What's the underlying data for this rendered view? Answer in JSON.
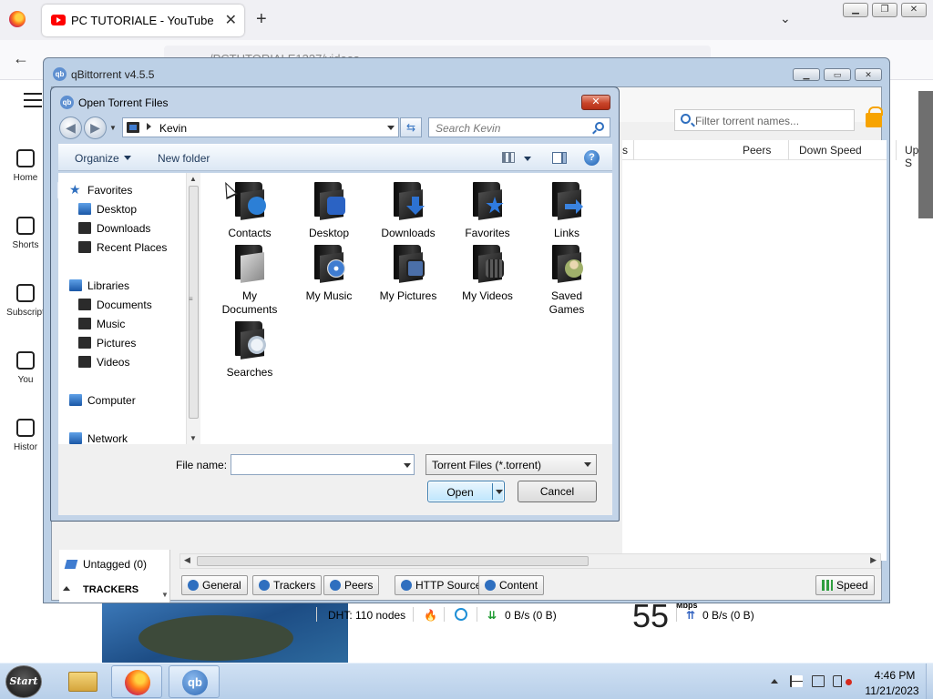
{
  "browser": {
    "tab_title": "PC TUTORIALE - YouTube",
    "tab_close": "✕",
    "new_tab": "+",
    "tab_list": "⌄",
    "url_partial": "/PCTUTORIALE1337/videos",
    "back_arrow": "←"
  },
  "youtube_sidebar": {
    "items": [
      {
        "label": "Home",
        "icon": "home-icon"
      },
      {
        "label": "Shorts",
        "icon": "shorts-icon"
      },
      {
        "label": "Subscript",
        "icon": "subscriptions-icon"
      },
      {
        "label": "You",
        "icon": "library-icon"
      },
      {
        "label": "Histor",
        "icon": "history-icon"
      }
    ]
  },
  "youtube_content": {
    "speed_value": "55",
    "speed_unit": "Mbps"
  },
  "qbittorrent": {
    "title": "qBittorrent v4.5.5",
    "filter_placeholder": "Filter torrent names...",
    "columns": [
      "s",
      "Peers",
      "Down Speed",
      "Up S"
    ],
    "untagged": "Untagged (0)",
    "trackers_header": "TRACKERS",
    "bottom_tabs": [
      "General",
      "Trackers",
      "Peers",
      "HTTP Sources",
      "Content"
    ],
    "speed_tab": "Speed",
    "status": {
      "dht": "DHT: 110 nodes",
      "download": "0 B/s (0 B)",
      "upload": "0 B/s (0 B)"
    }
  },
  "dialog": {
    "title": "Open Torrent Files",
    "close_symbol": "✕",
    "address": "Kevin",
    "search_placeholder": "Search Kevin",
    "organize": "Organize",
    "new_folder": "New folder",
    "help_symbol": "?",
    "nav": {
      "favorites": "Favorites",
      "favorites_items": [
        "Desktop",
        "Downloads",
        "Recent Places"
      ],
      "libraries": "Libraries",
      "libraries_items": [
        "Documents",
        "Music",
        "Pictures",
        "Videos"
      ],
      "computer": "Computer",
      "network": "Network"
    },
    "folders": [
      {
        "label": "Contacts",
        "accent": "#2c7fd6"
      },
      {
        "label": "Desktop",
        "accent": "#2b63c4"
      },
      {
        "label": "Downloads",
        "accent": "#2d72d2"
      },
      {
        "label": "Favorites",
        "accent": "#2f7be0"
      },
      {
        "label": "Links",
        "accent": "#3a83e0"
      },
      {
        "label": "My Documents",
        "accent": "#9a9a9a"
      },
      {
        "label": "My Music",
        "accent": "#3f7cd0"
      },
      {
        "label": "My Pictures",
        "accent": "#4b6fa8"
      },
      {
        "label": "My Videos",
        "accent": "#5a5a5a"
      },
      {
        "label": "Saved Games",
        "accent": "#a0b06a"
      },
      {
        "label": "Searches",
        "accent": "#b9c7d6"
      }
    ],
    "file_name_label": "File name:",
    "file_name_value": "",
    "file_type": "Torrent Files (*.torrent)",
    "open_button": "Open",
    "cancel_button": "Cancel"
  },
  "taskbar": {
    "start": "Start",
    "time": "4:46 PM",
    "date": "11/21/2023",
    "qb_letters": "qb"
  },
  "colors": {
    "dialog_frame": "#c3d4e8",
    "qb_frame": "#bcd0e6",
    "taskbar": "#b8cfe9",
    "accent_blue": "#2f6fbf"
  }
}
